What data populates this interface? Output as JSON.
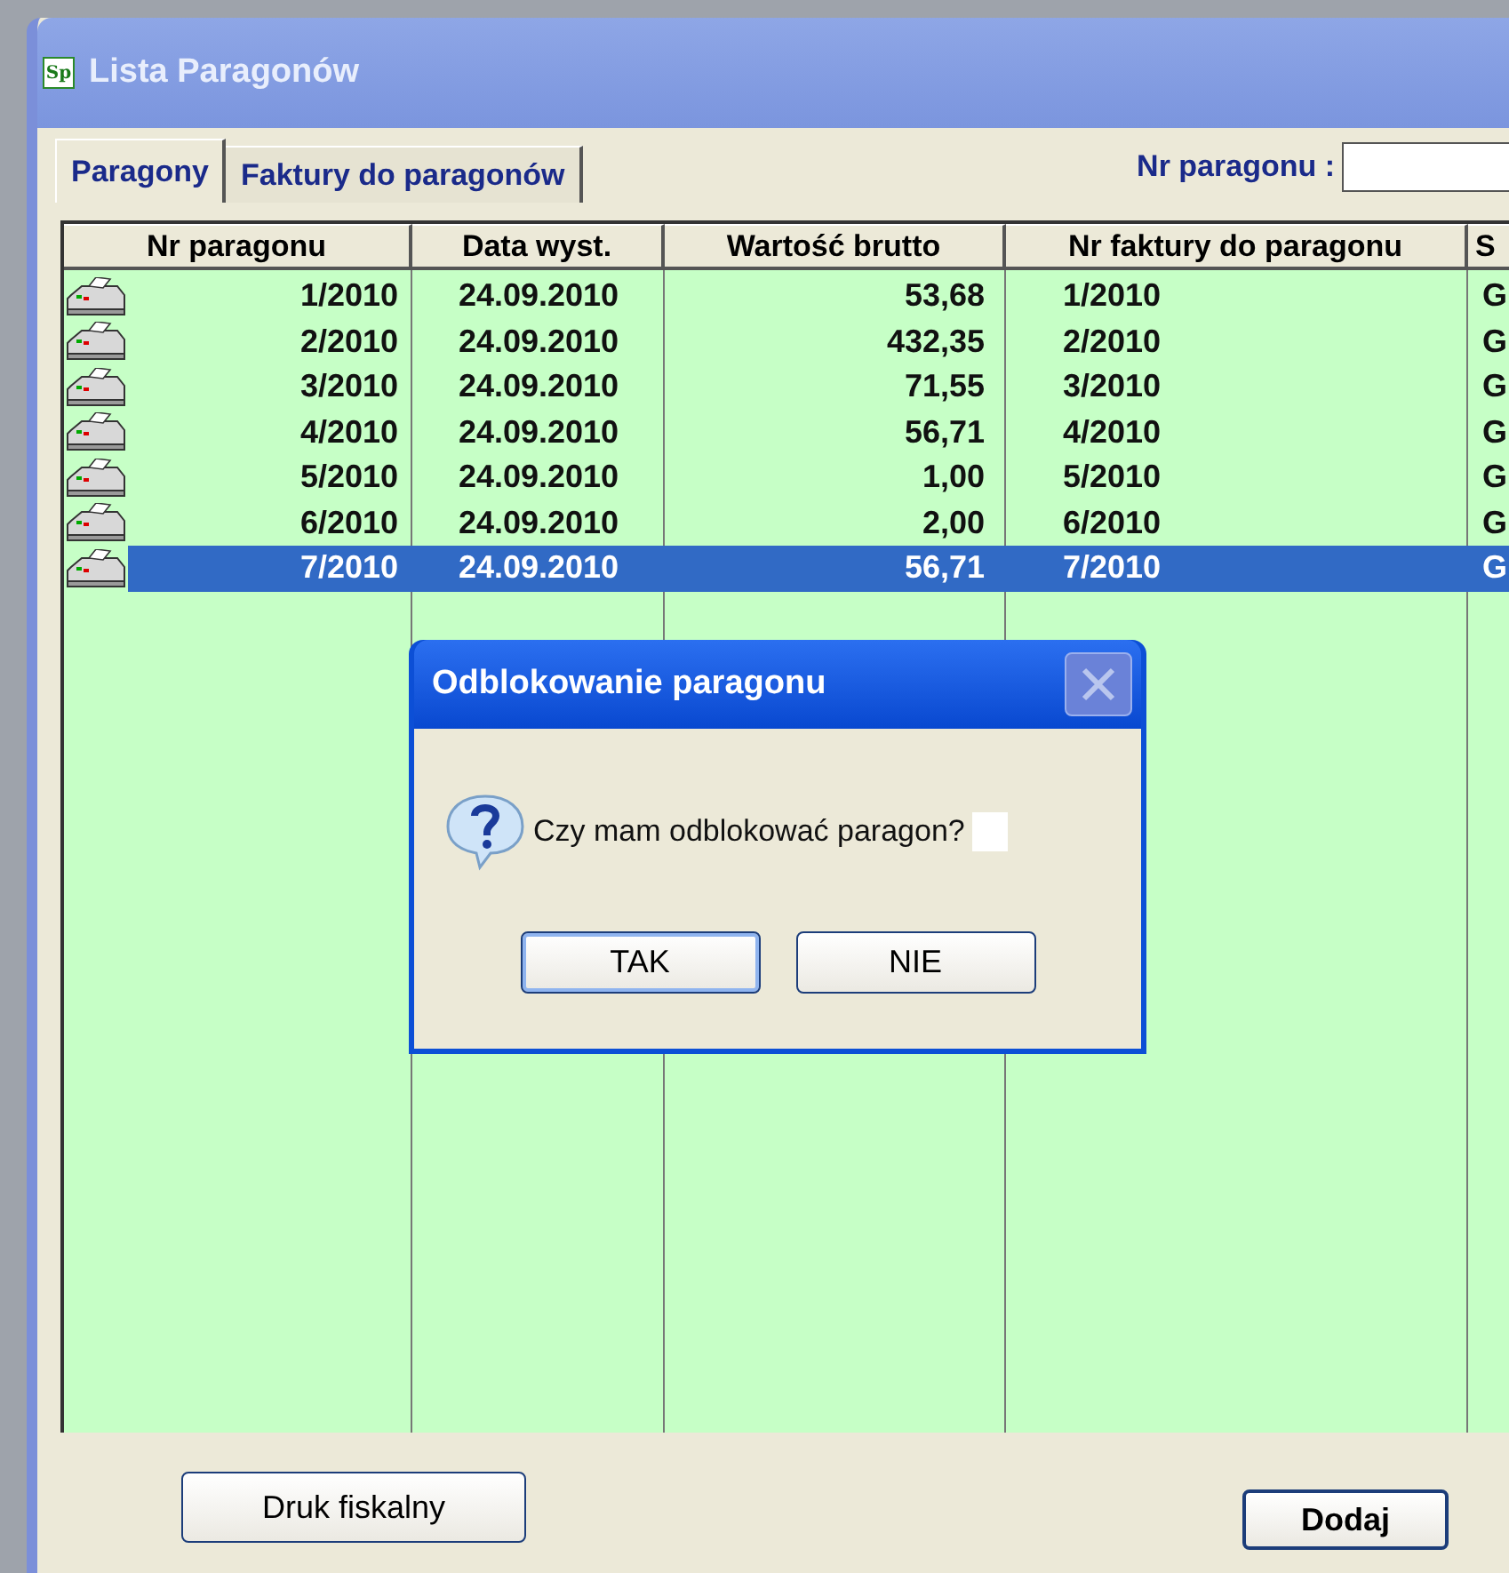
{
  "window": {
    "icon_text": "Sp",
    "title": "Lista Paragonów"
  },
  "tabs": [
    {
      "label": "Paragony",
      "selected": true
    },
    {
      "label": "Faktury do paragonów",
      "selected": false
    }
  ],
  "search": {
    "label": "Nr paragonu :"
  },
  "table": {
    "columns": [
      "Nr paragonu",
      "Data wyst.",
      "Wartość brutto",
      "Nr faktury do paragonu",
      "S"
    ],
    "rows": [
      {
        "cells": [
          "1/2010",
          "24.09.2010",
          "53,68",
          "1/2010",
          "G"
        ],
        "selected": false
      },
      {
        "cells": [
          "2/2010",
          "24.09.2010",
          "432,35",
          "2/2010",
          "G"
        ],
        "selected": false
      },
      {
        "cells": [
          "3/2010",
          "24.09.2010",
          "71,55",
          "3/2010",
          "G"
        ],
        "selected": false
      },
      {
        "cells": [
          "4/2010",
          "24.09.2010",
          "56,71",
          "4/2010",
          "G"
        ],
        "selected": false
      },
      {
        "cells": [
          "5/2010",
          "24.09.2010",
          "1,00",
          "5/2010",
          "G"
        ],
        "selected": false
      },
      {
        "cells": [
          "6/2010",
          "24.09.2010",
          "2,00",
          "6/2010",
          "G"
        ],
        "selected": false
      },
      {
        "cells": [
          "7/2010",
          "24.09.2010",
          "56,71",
          "7/2010",
          "G"
        ],
        "selected": true
      }
    ]
  },
  "buttons": [
    {
      "label": "Druk fiskalny",
      "kind": "normal"
    },
    {
      "label": "Dodaj",
      "kind": "bold"
    }
  ],
  "dialog": {
    "title": "Odblokowanie paragonu",
    "message": "Czy mam odblokować paragon?",
    "buttons": [
      {
        "label": "TAK",
        "default": true
      },
      {
        "label": "NIE",
        "default": false
      }
    ]
  }
}
